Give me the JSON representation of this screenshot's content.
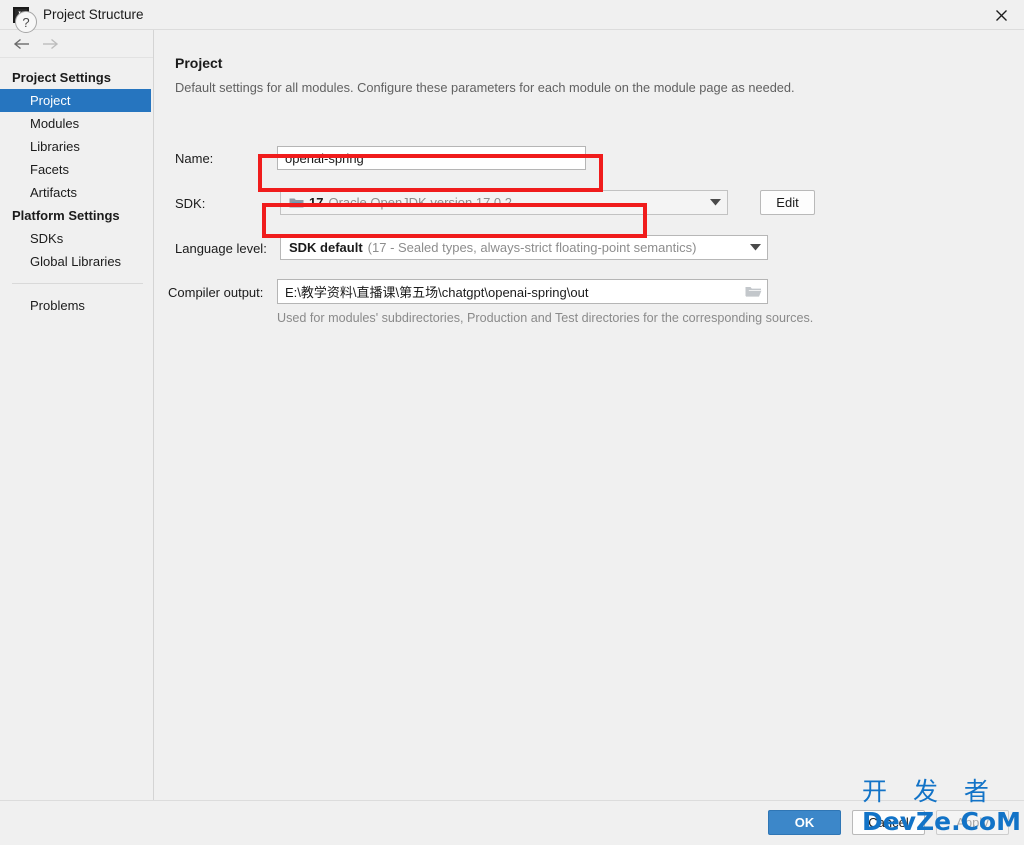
{
  "window": {
    "title": "Project Structure",
    "logo_text": "IJ",
    "close_label": "✕"
  },
  "nav": {
    "back_label": "←",
    "forward_label": "→"
  },
  "sidebar": {
    "groups": [
      {
        "title": "Project Settings",
        "items": [
          {
            "label": "Project",
            "selected": true
          },
          {
            "label": "Modules",
            "selected": false
          },
          {
            "label": "Libraries",
            "selected": false
          },
          {
            "label": "Facets",
            "selected": false
          },
          {
            "label": "Artifacts",
            "selected": false
          }
        ]
      },
      {
        "title": "Platform Settings",
        "items": [
          {
            "label": "SDKs",
            "selected": false
          },
          {
            "label": "Global Libraries",
            "selected": false
          }
        ]
      }
    ],
    "problems_label": "Problems"
  },
  "main": {
    "title": "Project",
    "description": "Default settings for all modules. Configure these parameters for each module on the module page as needed.",
    "name": {
      "label": "Name:",
      "value": "openai-spring"
    },
    "sdk": {
      "label": "SDK:",
      "version_badge": "17",
      "value": "Oracle OpenJDK version 17.0.2",
      "edit_label": "Edit"
    },
    "language_level": {
      "label": "Language level:",
      "value_strong": "SDK default",
      "value_muted": "(17 - Sealed types, always-strict floating-point semantics)"
    },
    "compiler_output": {
      "label": "Compiler output:",
      "value": "E:\\教学资料\\直播课\\第五场\\chatgpt\\openai-spring\\out",
      "hint": "Used for modules' subdirectories, Production and Test directories for the corresponding sources."
    }
  },
  "annotations": {
    "accent_color": "#f01c1c",
    "boxes": [
      {
        "name": "sdk-highlight"
      },
      {
        "name": "language-level-highlight"
      }
    ]
  },
  "footer": {
    "help_label": "?",
    "ok_label": "OK",
    "cancel_label": "Cancel",
    "apply_label": "Apply"
  },
  "watermark": {
    "cn": "开 发 者",
    "en": "DevZe.CoM",
    "color": "#1273c7"
  }
}
